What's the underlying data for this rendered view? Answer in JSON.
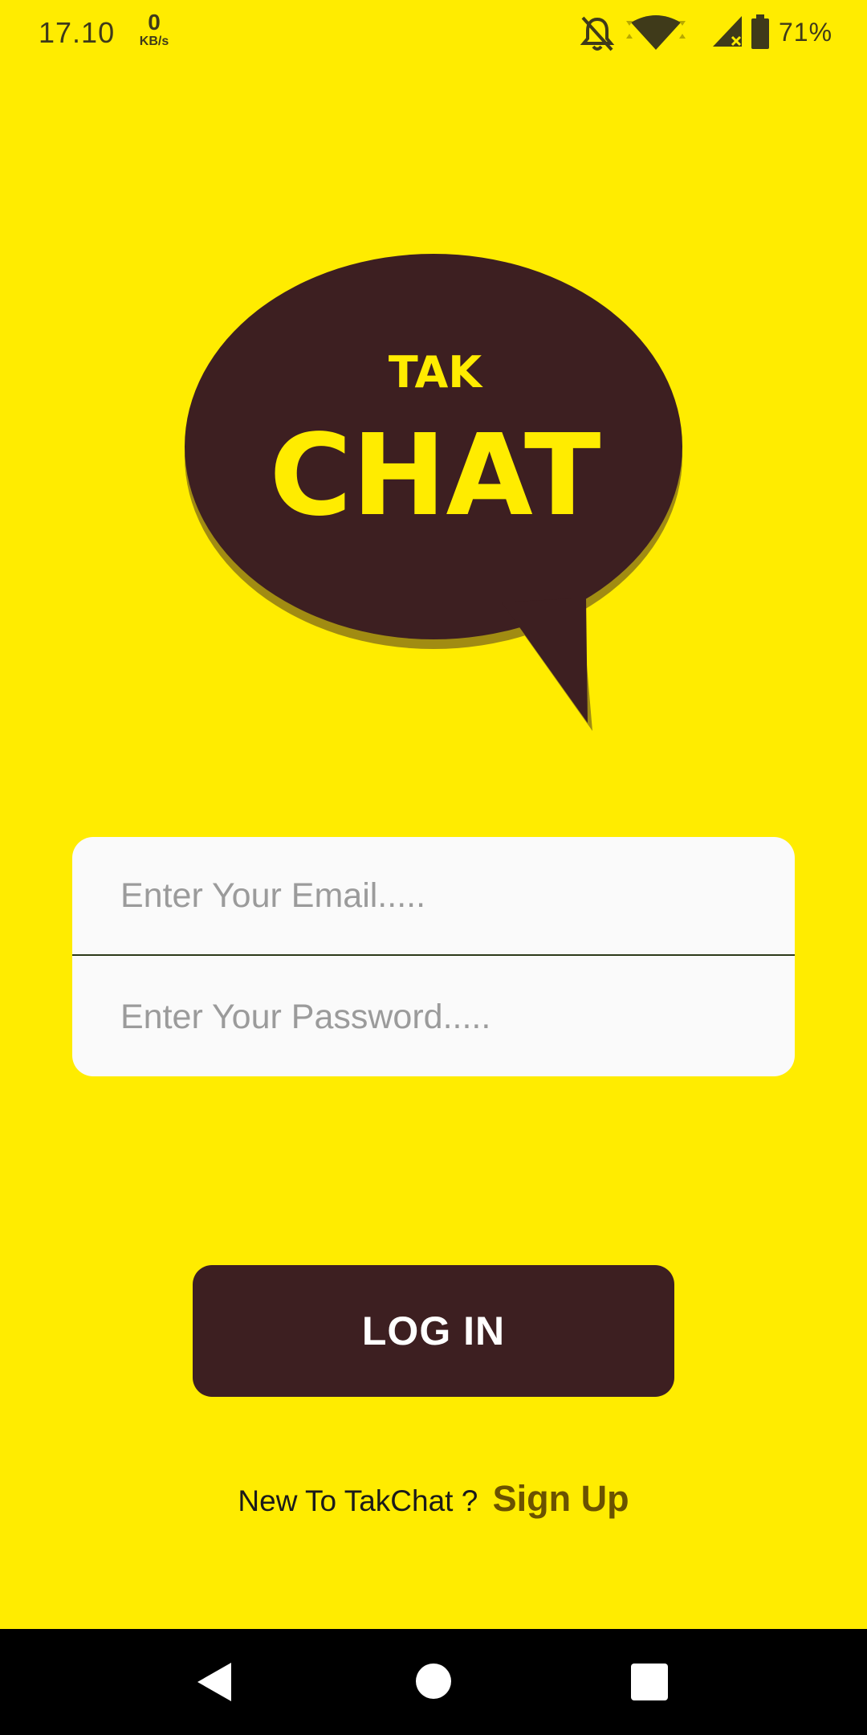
{
  "status_bar": {
    "time": "17.10",
    "net_speed_value": "0",
    "net_speed_unit": "KB/s",
    "battery_percent": "71%",
    "icons": [
      "notifications-off-icon",
      "wifi-icon",
      "signal-icon",
      "battery-icon"
    ]
  },
  "logo": {
    "line1": "TAK",
    "line2": "CHAT",
    "bubble_color": "#3D1F21",
    "text_color": "#FFEC00"
  },
  "login_form": {
    "email_placeholder": "Enter Your Email.....",
    "password_placeholder": "Enter Your Password....."
  },
  "login_button_label": "LOG IN",
  "signup": {
    "prompt": "New To TakChat ?",
    "link_label": "Sign Up"
  },
  "nav_bar": {
    "icons": [
      "back-icon",
      "home-icon",
      "recents-icon"
    ]
  },
  "colors": {
    "background": "#FFEC00",
    "accent_dark": "#3D1F21",
    "link": "#6B5200"
  }
}
